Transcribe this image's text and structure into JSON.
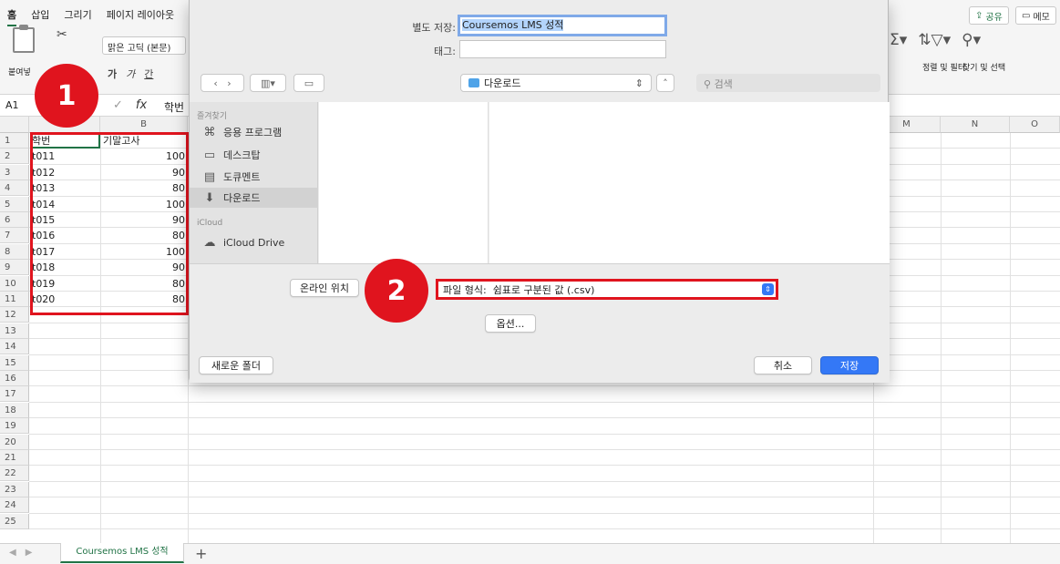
{
  "ribbon": {
    "tabs": [
      "홈",
      "삽입",
      "그리기",
      "페이지 레이아웃"
    ],
    "share_label": "공유",
    "memo_label": "메모",
    "paste_label": "붙여넣",
    "font_name": "맑은 고딕 (본문)",
    "font_styles": [
      "가",
      "가",
      "간"
    ],
    "sort_filter_label": "정렬 및 필터",
    "find_select_label": "찾기 및 선택"
  },
  "formula_bar": {
    "namebox": "A1",
    "fx": "fx",
    "value": "학번"
  },
  "grid": {
    "columns": [
      "B",
      "M",
      "N",
      "O"
    ],
    "rows": [
      "1",
      "2",
      "3",
      "4",
      "5",
      "6",
      "7",
      "8",
      "9",
      "10",
      "11",
      "12",
      "13",
      "14",
      "15",
      "16",
      "17",
      "18",
      "19",
      "20",
      "21",
      "22",
      "23",
      "24",
      "25"
    ],
    "header": {
      "a": "학번",
      "b": "기말고사"
    },
    "data": [
      {
        "a": "t011",
        "b": "100"
      },
      {
        "a": "t012",
        "b": "90"
      },
      {
        "a": "t013",
        "b": "80"
      },
      {
        "a": "t014",
        "b": "100"
      },
      {
        "a": "t015",
        "b": "90"
      },
      {
        "a": "t016",
        "b": "80"
      },
      {
        "a": "t017",
        "b": "100"
      },
      {
        "a": "t018",
        "b": "90"
      },
      {
        "a": "t019",
        "b": "80"
      },
      {
        "a": "t020",
        "b": "80"
      }
    ]
  },
  "sheet": {
    "tab_name": "Coursemos LMS 성적"
  },
  "dialog": {
    "save_as_label": "별도 저장:",
    "filename": "Coursemos LMS 성적",
    "tags_label": "태그:",
    "location": "다운로드",
    "search_placeholder": "검색",
    "favorites_label": "즐겨찾기",
    "sidebar_items": [
      "응용 프로그램",
      "데스크탑",
      "도큐멘트",
      "다운로드"
    ],
    "icloud_label": "iCloud",
    "icloud_drive": "iCloud Drive",
    "online_location": "온라인 위치",
    "format_label": "파일 형식:",
    "format_value": "쉼표로 구분된 값 (.csv)",
    "options": "옵션...",
    "new_folder": "새로운 폴더",
    "cancel": "취소",
    "save": "저장"
  },
  "annotations": {
    "badge1": "1",
    "badge2": "2",
    "color": "#e0141e"
  },
  "colors": {
    "excel_green": "#217346",
    "mac_blue": "#3478f6"
  }
}
